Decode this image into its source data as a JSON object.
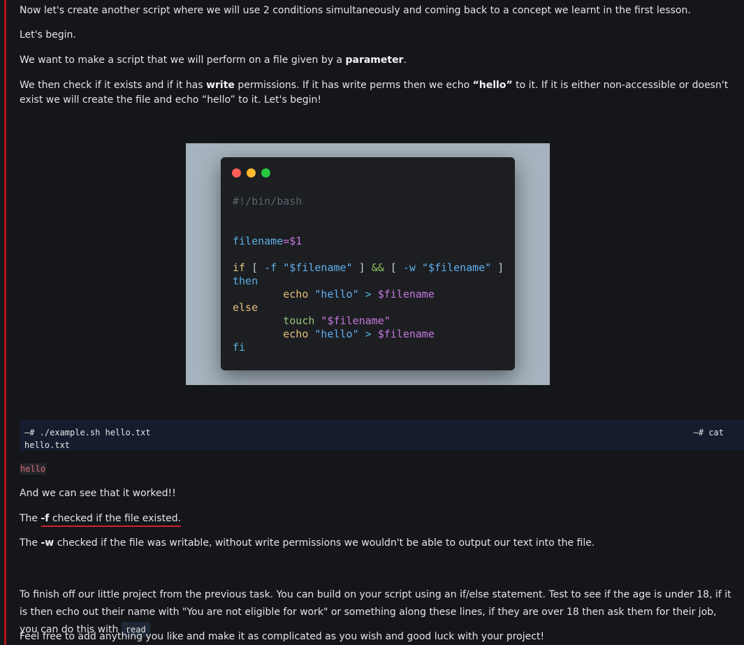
{
  "paragraphs": {
    "intro": "Now let's create another script where we will use 2 conditions simultaneously and coming back to a concept we learnt in the first lesson.",
    "begin": "Let's begin.",
    "want_pre": "We want to make a script that we will perform on a file given by a ",
    "want_bold": "parameter",
    "want_post": ".",
    "check_1": "We then check if it exists and if it has ",
    "check_bold_1": "write",
    "check_2": " permissions. If it has write perms then we echo ",
    "check_bold_2": "“hello”",
    "check_3": " to it. If it is either non-accessible or doesn't exist we will create the file and echo “hello” to it. Let's begin!",
    "worked": "And we can see that it worked!!",
    "f_pre": "The ",
    "f_bold": "-f",
    "f_post": " checked if the file existed.",
    "w_pre": "The ",
    "w_bold": "-w",
    "w_post": " checked if the file was writable, without write permissions we wouldn't be able to output our text into the file.",
    "finish": "To finish off our little project from the previous task. You can build on your script using an if/else statement. Test to see if the age is under 18, if it is then echo out their name with \"You are not eligible for work\" or something along these lines, if they are over 18 then ask them for their job, you can do this with ",
    "finish_code": "read",
    "feel_free": "Feel free to add anything you like and make it as complicated as you wish and good luck with your project!"
  },
  "code_image": {
    "shebang": "#!/bin/bash",
    "assign_var": "filename",
    "assign_eq": "=",
    "assign_val": "$1",
    "if_kw": "if",
    "if_open": " [ ",
    "flag_f": "-f",
    "str_f": " \"$filename\"",
    "close1": " ] ",
    "and_op": "&&",
    "open2": " [ ",
    "flag_w": "-w",
    "str_w": " \"$filename\"",
    "close2": " ]",
    "then_kw": "then",
    "echo1": "echo",
    "hello1": " \"hello\"",
    "redir1": " > ",
    "var1": "$filename",
    "else_kw": "else",
    "touch": "touch",
    "touch_arg": " \"$filename\"",
    "echo2": "echo",
    "hello2": " \"hello\"",
    "redir2": " > ",
    "var2": "$filename",
    "fi_kw": "fi"
  },
  "terminal": {
    "line1": "—# ./example.sh hello.txt",
    "line1_right": "—# cat",
    "line2": "hello.txt"
  },
  "output_value": "hello",
  "colors": {
    "accent_rule": "#b0151a",
    "background": "#141619",
    "terminal_bg": "#151c2e"
  }
}
